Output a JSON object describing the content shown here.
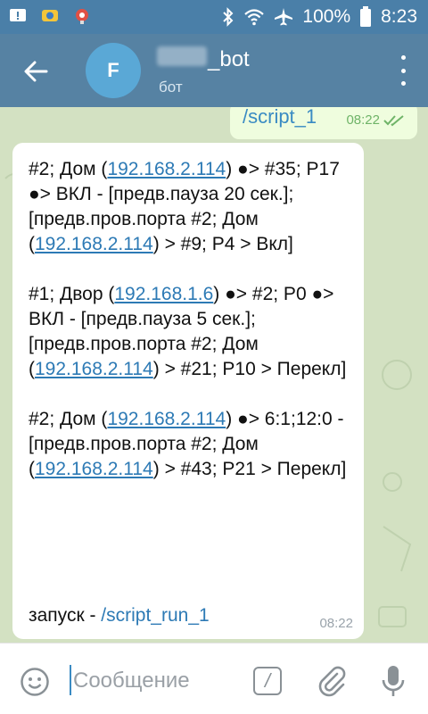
{
  "status_bar": {
    "battery": "100%",
    "time": "8:23"
  },
  "header": {
    "avatar_letter": "F",
    "bot_name_suffix": "_bot",
    "status": "бот"
  },
  "outgoing": {
    "text": "/script_1",
    "time": "08:22"
  },
  "incoming": {
    "paragraphs": [
      {
        "p1": "#2; Дом (",
        "link1": "192.168.2.114",
        "p2": ") ●> #35; P17 ●> ВКЛ - [предв.пауза 20 сек.]; [предв.пров.порта #2; Дом (",
        "link2": "192.168.2.114",
        "p3": ") > #9; P4 > Вкл]"
      },
      {
        "p1": "#1; Двор (",
        "link1": "192.168.1.6",
        "p2": ") ●> #2; P0 ●> ВКЛ - [предв.пауза 5 сек.]; [предв.пров.порта #2; Дом (",
        "link2": "192.168.2.114",
        "p3": ") > #21; P10 > Перекл]"
      },
      {
        "p1": "#2; Дом (",
        "link1": "192.168.2.114",
        "p2": ") ●> 6:1;12:0 - [предв.пров.порта #2; Дом (",
        "link2": "192.168.2.114",
        "p3": ") > #43; P21 > Перекл]"
      }
    ],
    "run_label": "запуск - ",
    "run_command": "/script_run_1",
    "time": "08:22"
  },
  "input": {
    "placeholder": "Сообщение",
    "command_glyph": "/"
  },
  "colors": {
    "status_bar": "#4a7fa8",
    "header": "#5682a3",
    "avatar": "#5aa8d6",
    "chat_bg": "#d3e1c2",
    "link": "#2d7ab5",
    "outgoing_bubble": "#effdde",
    "check": "#6fb468"
  }
}
